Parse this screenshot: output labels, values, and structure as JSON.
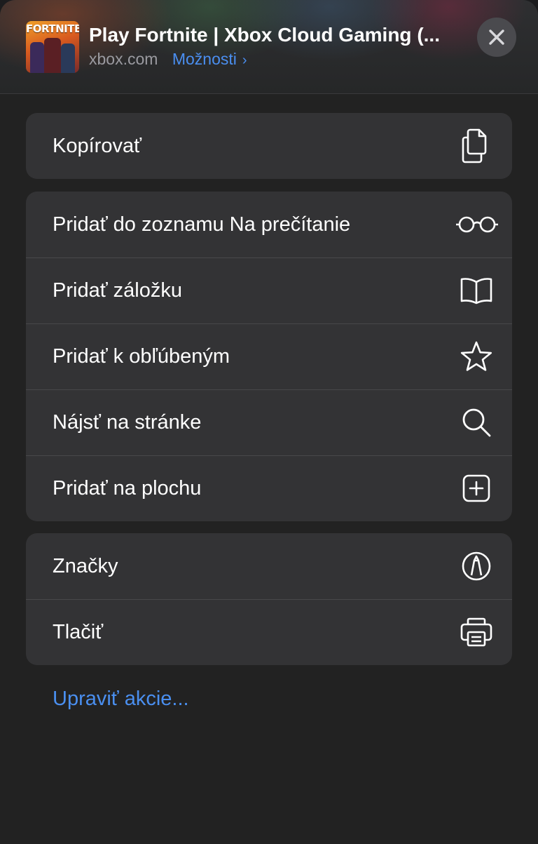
{
  "header": {
    "title": "Play Fortnite | Xbox Cloud Gaming (...",
    "domain": "xbox.com",
    "options_label": "Možnosti",
    "app_icon_text": "FORTNITE",
    "close_icon": "close-icon"
  },
  "groups": [
    {
      "items": [
        {
          "label": "Kopírovať",
          "icon": "copy-icon"
        }
      ]
    },
    {
      "items": [
        {
          "label": "Pridať do zoznamu Na prečítanie",
          "icon": "glasses-icon"
        },
        {
          "label": "Pridať záložku",
          "icon": "book-icon"
        },
        {
          "label": "Pridať k obľúbeným",
          "icon": "star-icon"
        },
        {
          "label": "Nájsť na stránke",
          "icon": "search-icon"
        },
        {
          "label": "Pridať na plochu",
          "icon": "add-square-icon"
        }
      ]
    },
    {
      "items": [
        {
          "label": "Značky",
          "icon": "markup-icon"
        },
        {
          "label": "Tlačiť",
          "icon": "printer-icon"
        }
      ]
    }
  ],
  "edit_actions_label": "Upraviť akcie...",
  "colors": {
    "accent": "#4a8ff0",
    "sheet_background": "#222222",
    "group_background": "#333335",
    "separator": "#48484a"
  }
}
